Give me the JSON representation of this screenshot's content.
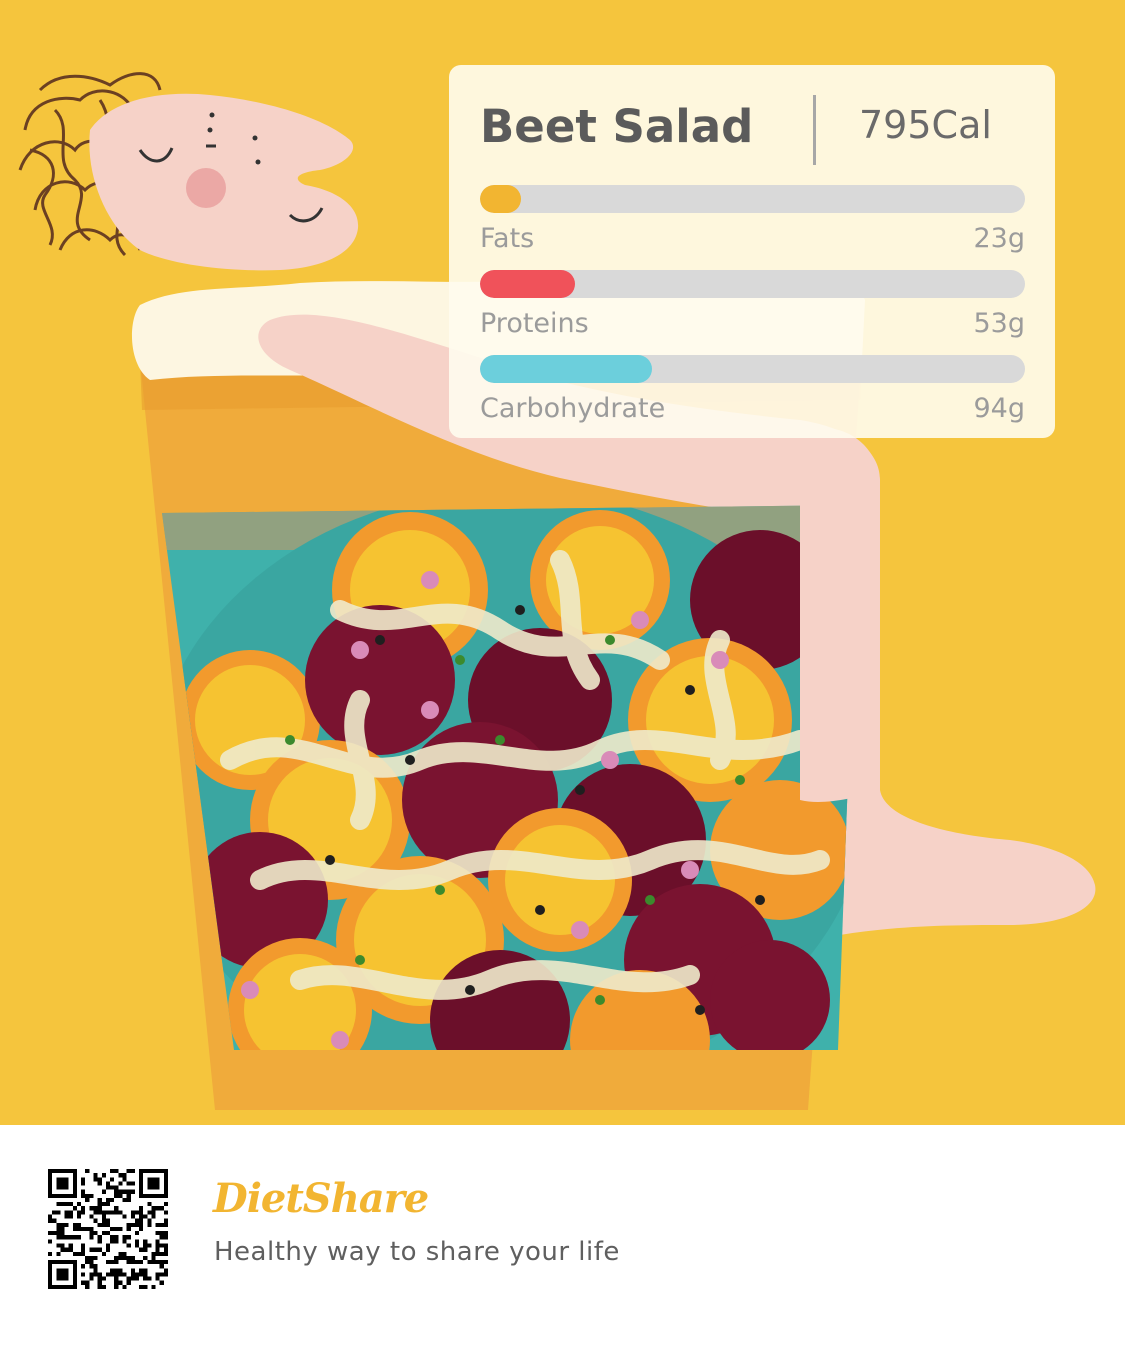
{
  "card": {
    "title": "Beet Salad",
    "calories": "795Cal",
    "nutrients": [
      {
        "label": "Fats",
        "value": "23g",
        "fraction": 0.075,
        "color": "#f2b531"
      },
      {
        "label": "Proteins",
        "value": "53g",
        "fraction": 0.175,
        "color": "#f0525a"
      },
      {
        "label": "Carbohydrate",
        "value": "94g",
        "fraction": 0.315,
        "color": "#6ccfdc"
      }
    ]
  },
  "footer": {
    "brand": "DietShare",
    "tagline": "Healthy way to share your life"
  },
  "colors": {
    "background": "#f5c53d",
    "cup": "#f0ab3b",
    "skin": "#f6d2c8",
    "hair": "#6b4022",
    "plate": "#3fb1ab",
    "brand": "#f2b531"
  }
}
